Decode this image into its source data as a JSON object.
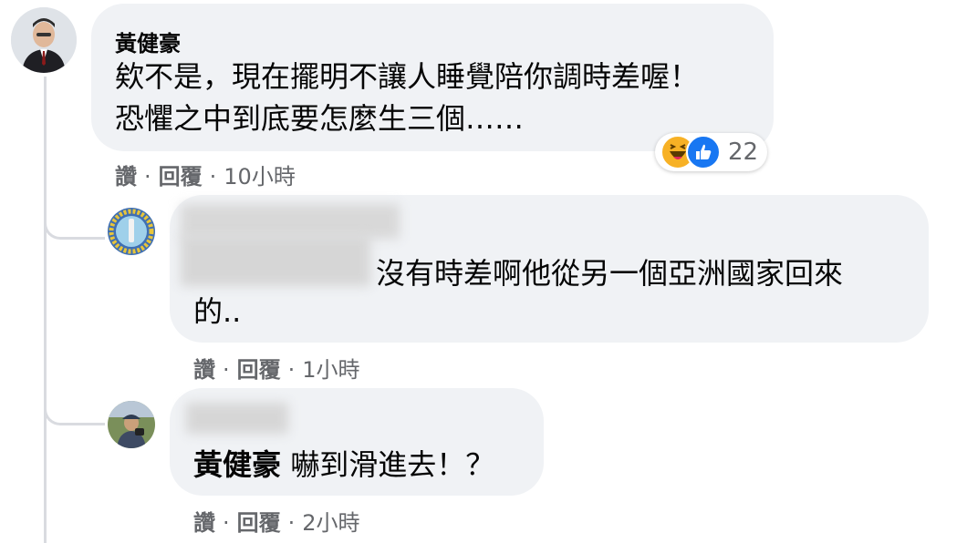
{
  "comments": [
    {
      "author": "黃健豪",
      "text_lines": [
        "欸不是，現在擺明不讓人睡覺陪你調時差喔！",
        "恐懼之中到底要怎麼生三個……"
      ],
      "actions": {
        "like": "讚",
        "reply": "回覆",
        "time": "10小時"
      },
      "reactions": {
        "icons": [
          "laugh-icon",
          "like-icon"
        ],
        "count": "22"
      }
    },
    {
      "author": "",
      "text_lines": [
        "沒有時差啊他從另一個亞洲國家回來",
        "的.."
      ],
      "actions": {
        "like": "讚",
        "reply": "回覆",
        "time": "1小時"
      }
    },
    {
      "author": "",
      "mention": "黃健豪",
      "text": "嚇到滑進去！？",
      "actions": {
        "like": "讚",
        "reply": "回覆",
        "time": "2小時"
      }
    }
  ],
  "separator": "·",
  "colors": {
    "bubble": "#f0f2f5",
    "meta": "#65676b",
    "like_blue": "#1877f2",
    "laugh_yellow": "#f7b125"
  }
}
